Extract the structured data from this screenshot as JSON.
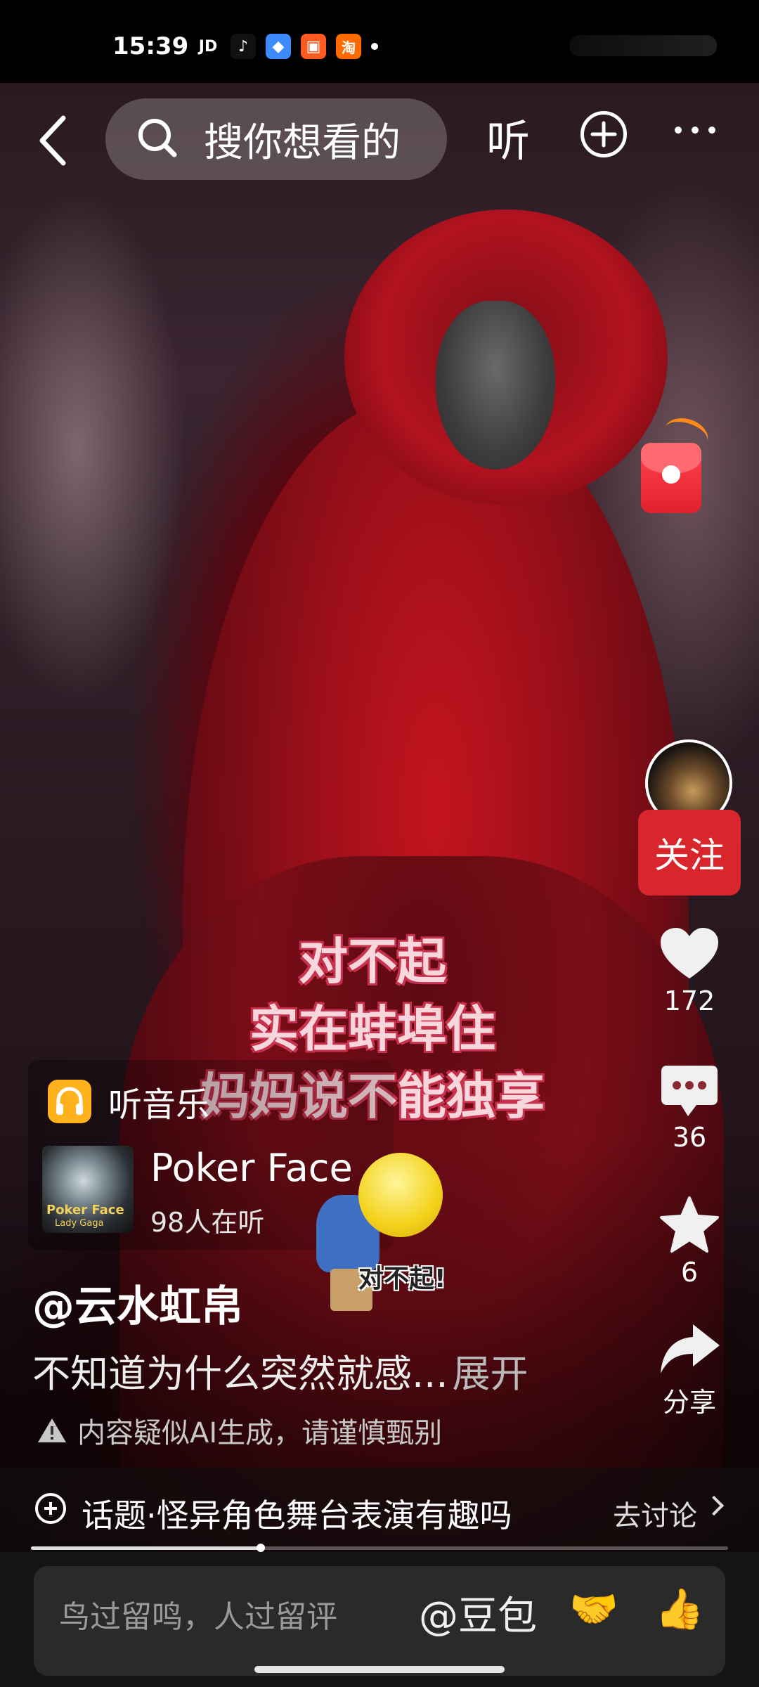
{
  "status_bar": {
    "time": "15:39",
    "apps": [
      "JD",
      "♪",
      "◆",
      "▣",
      "淘"
    ]
  },
  "header": {
    "search_placeholder": "搜你想看的",
    "listen_label": "听"
  },
  "video": {
    "subtitles": [
      "对不起",
      "实在蚌埠住",
      "妈妈说不能独享"
    ],
    "sticker_text": "对不起!"
  },
  "actions": {
    "follow_label": "关注",
    "like_count": "172",
    "comment_count": "36",
    "favorite_count": "6",
    "share_label": "分享"
  },
  "music": {
    "label": "听音乐",
    "song_title": "Poker Face",
    "listeners": "98人在听",
    "album_title": "Poker Face",
    "album_artist": "Lady Gaga"
  },
  "post": {
    "author": "@云水虹帛",
    "description": "不知道为什么突然就感...",
    "expand_label": "展开",
    "ai_notice": "内容疑似AI生成，请谨慎甄别"
  },
  "topic": {
    "text": "话题·怪异角色舞台表演有趣吗",
    "action": "去讨论"
  },
  "progress": {
    "fraction": 0.33
  },
  "comment_bar": {
    "placeholder": "鸟过留鸣，人过留评",
    "mention": "@豆包",
    "emoji_1": "🤝",
    "emoji_2": "👍"
  },
  "colors": {
    "follow_red": "#d9262c",
    "music_icon": "#ffb21c",
    "subtitle_outline": "#c8334f"
  }
}
